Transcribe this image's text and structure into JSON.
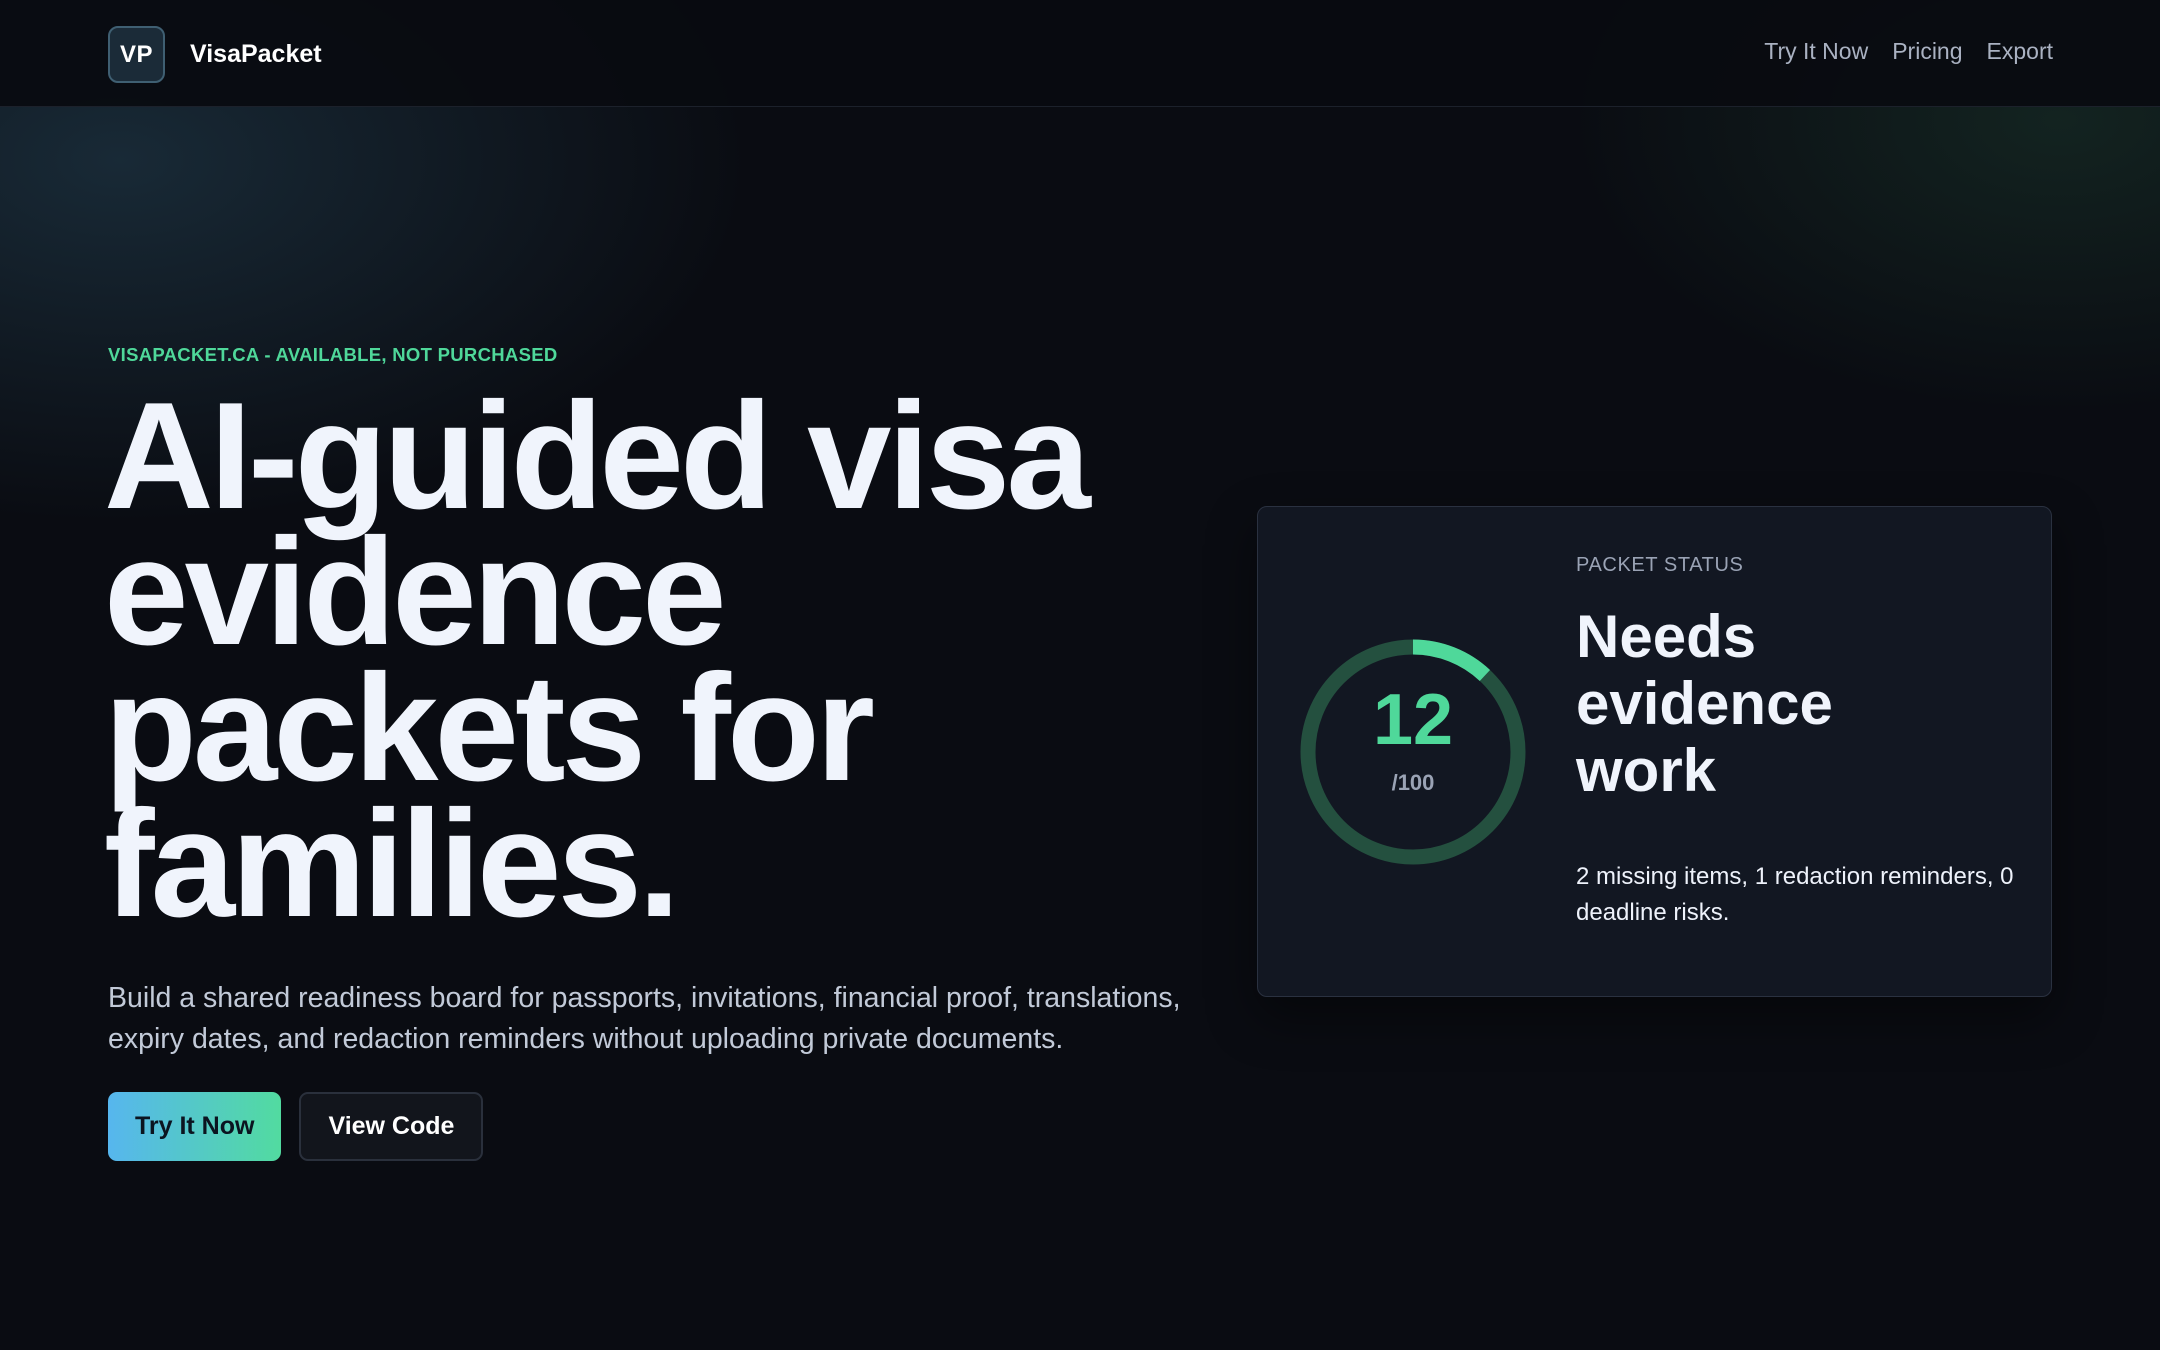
{
  "brand": {
    "logo_text": "VP",
    "name": "VisaPacket"
  },
  "nav": {
    "items": [
      "Try It Now",
      "Pricing",
      "Export"
    ]
  },
  "hero": {
    "eyebrow": "VISAPACKET.CA - AVAILABLE, NOT PURCHASED",
    "headline": "AI-guided visa evidence packets for families.",
    "subtitle": "Build a shared readiness board for passports, invitations, financial proof, translations, expiry dates, and redaction reminders without uploading private documents.",
    "cta_primary": "Try It Now",
    "cta_secondary": "View Code"
  },
  "status_card": {
    "label": "PACKET STATUS",
    "score": 12,
    "score_max_label": "/100",
    "score_fraction": 0.12,
    "title": "Needs evidence work",
    "detail": "2 missing items, 1 redaction reminders, 0 deadline risks."
  },
  "colors": {
    "accent_green": "#4fd89a",
    "accent_blue": "#56b6ee",
    "background": "#0a0c12",
    "card": "#121722",
    "gauge_track": "#24503f"
  }
}
